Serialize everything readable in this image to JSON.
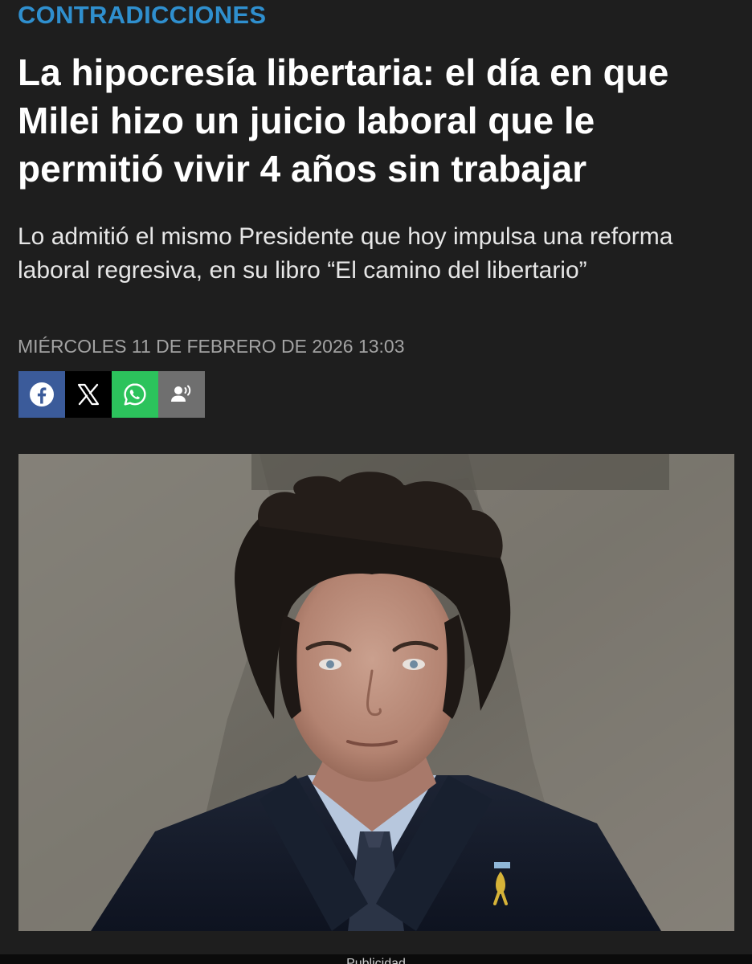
{
  "article": {
    "section": "CONTRADICCIONES",
    "headline": "La hipocresía libertaria: el día en que Milei hizo un juicio laboral que le permitió vivir 4 años sin trabajar",
    "subheadline": "Lo admitió el mismo Presidente que hoy impulsa una reforma laboral regresiva, en su libro “El camino del libertario”",
    "date": "MIÉRCOLES 11 DE FEBRERO DE 2026 13:03"
  },
  "share": {
    "buttons": [
      {
        "name": "facebook",
        "icon": "facebook-icon",
        "color": "#3b5b9a"
      },
      {
        "name": "x",
        "icon": "x-icon",
        "color": "#000000"
      },
      {
        "name": "whatsapp",
        "icon": "whatsapp-icon",
        "color": "#2cc35c"
      },
      {
        "name": "listen",
        "icon": "listen-icon",
        "color": "#6f6f6f"
      }
    ]
  },
  "ad": {
    "label": "Publicidad"
  },
  "colors": {
    "background": "#1e1e1e",
    "section_accent": "#2f8fce",
    "date_text": "#a3a3a3"
  }
}
